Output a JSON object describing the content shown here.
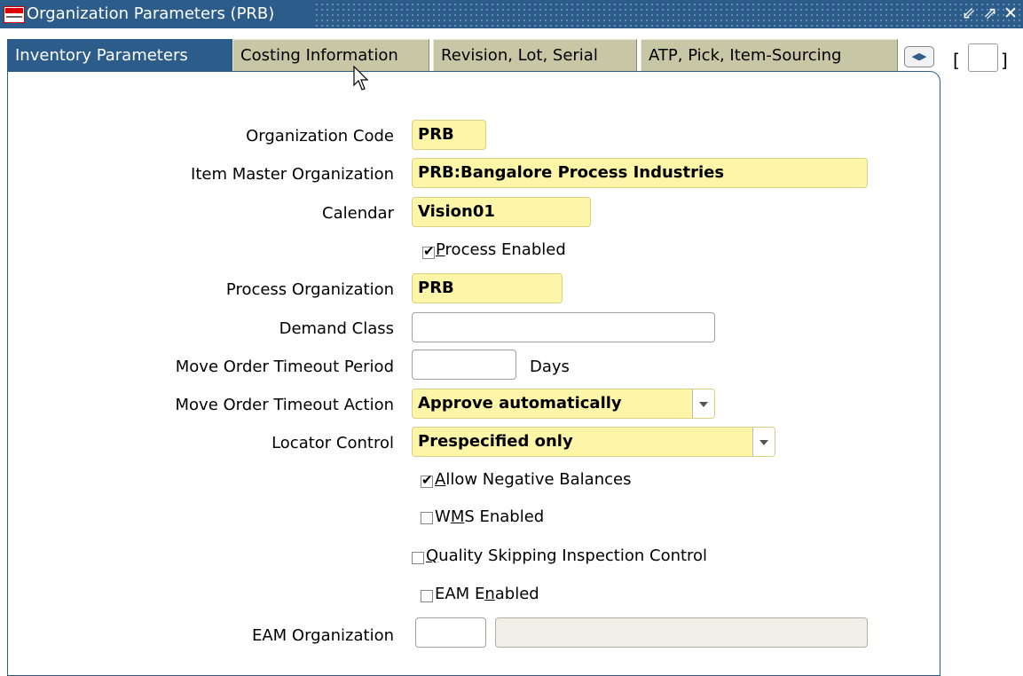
{
  "window": {
    "title": "Organization Parameters (PRB)",
    "controls": [
      "minimize",
      "maximize",
      "close"
    ]
  },
  "tabs": [
    {
      "label": "Inventory Parameters",
      "active": true
    },
    {
      "label": "Costing Information",
      "active": false
    },
    {
      "label": "Revision, Lot, Serial",
      "active": false
    },
    {
      "label": "ATP, Pick, Item-Sourcing",
      "active": false
    }
  ],
  "tab_nav": {
    "brackets_left": "[",
    "brackets_right": "]"
  },
  "form": {
    "org_code": {
      "label": "Organization Code",
      "value": "PRB"
    },
    "item_master": {
      "label": "Item Master Organization",
      "value": "PRB:Bangalore Process Industries"
    },
    "calendar": {
      "label": "Calendar",
      "value": "Vision01"
    },
    "process_enabled": {
      "label_pre": "",
      "label_u": "P",
      "label_post": "rocess Enabled",
      "checked": true
    },
    "process_org": {
      "label": "Process Organization",
      "value": "PRB"
    },
    "demand_class": {
      "label": "Demand Class",
      "value": ""
    },
    "timeout_period": {
      "label": "Move Order Timeout Period",
      "value": "",
      "unit": "Days"
    },
    "timeout_action": {
      "label": "Move Order Timeout Action",
      "value": "Approve automatically"
    },
    "locator_control": {
      "label": "Locator Control",
      "value": "Prespecified only"
    },
    "allow_negative": {
      "label_pre": "",
      "label_u": "A",
      "label_post": "llow Negative Balances",
      "checked": true
    },
    "wms_enabled": {
      "label_pre": "W",
      "label_u": "M",
      "label_post": "S Enabled",
      "checked": false
    },
    "quality_skip": {
      "label_pre": "",
      "label_u": "Q",
      "label_post": "uality Skipping Inspection Control",
      "checked": false
    },
    "eam_enabled": {
      "label_pre": "EAM E",
      "label_u": "n",
      "label_post": "abled",
      "checked": false
    },
    "eam_org": {
      "label": "EAM Organization",
      "value": "",
      "name_value": ""
    }
  }
}
